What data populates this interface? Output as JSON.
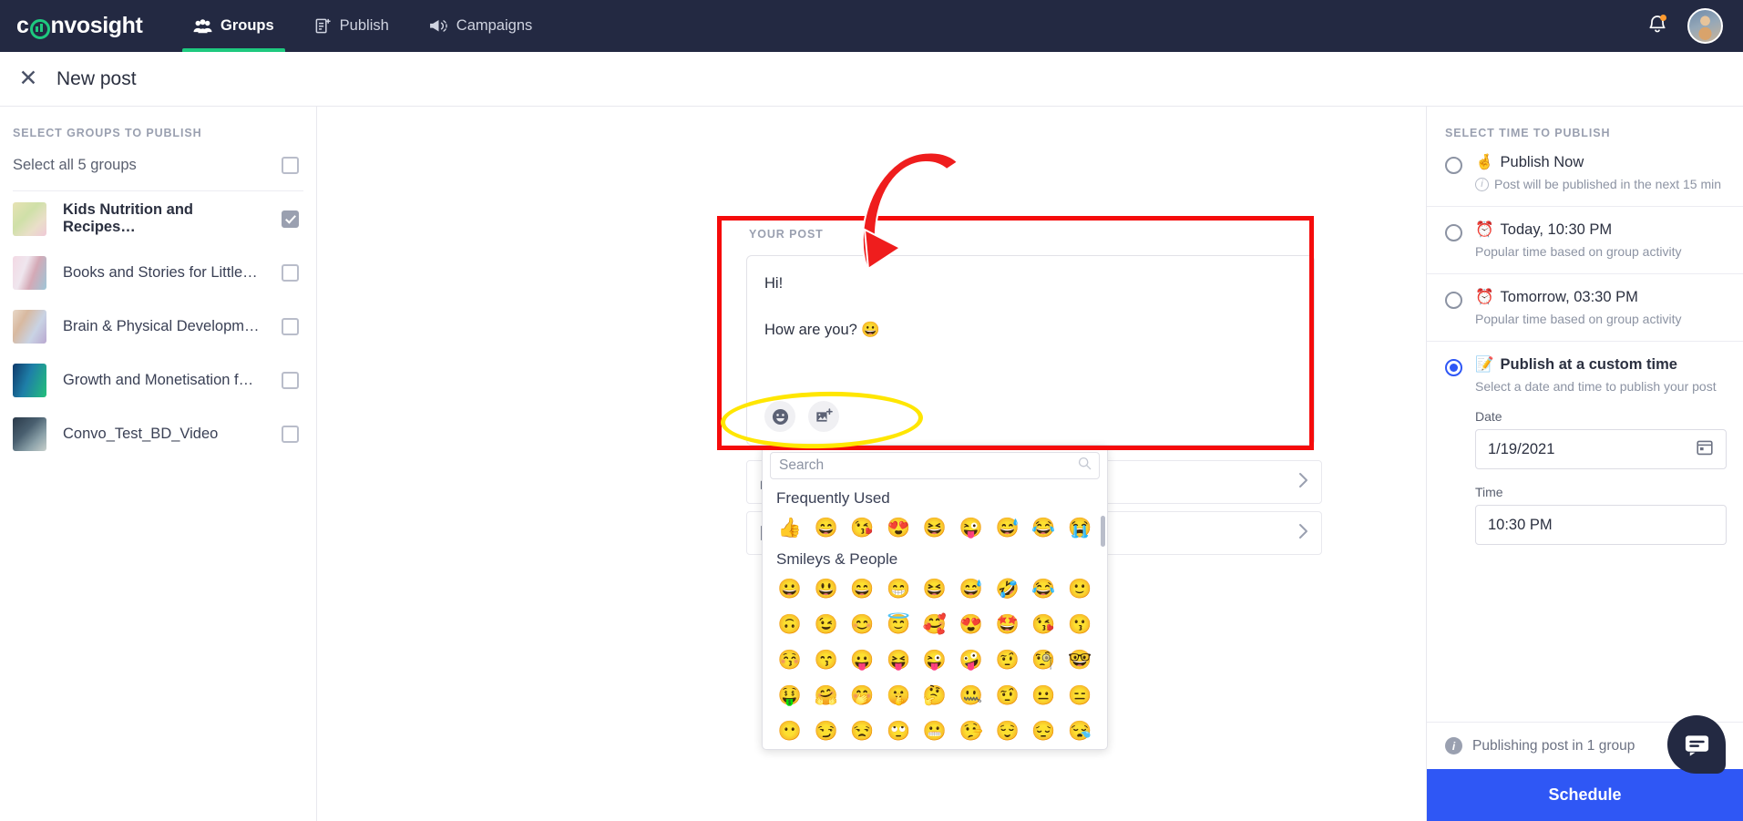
{
  "brand": {
    "name_pre": "c",
    "name_post": "nvosight"
  },
  "topnav": {
    "items": [
      {
        "label": "Groups",
        "icon": "groups-icon",
        "active": true
      },
      {
        "label": "Publish",
        "icon": "publish-icon",
        "active": false
      },
      {
        "label": "Campaigns",
        "icon": "campaigns-icon",
        "active": false
      }
    ],
    "notification_icon": "bell-icon",
    "avatar_icon": "user-avatar"
  },
  "subheader": {
    "close_icon": "close-icon",
    "title": "New post"
  },
  "left": {
    "section_label": "SELECT GROUPS TO PUBLISH",
    "select_all_label": "Select all 5 groups",
    "select_all_checked": false,
    "groups": [
      {
        "name": "Kids Nutrition and Recipes…",
        "checked": true
      },
      {
        "name": "Books and Stories for Little…",
        "checked": false
      },
      {
        "name": "Brain & Physical Developm…",
        "checked": false
      },
      {
        "name": "Growth and Monetisation f…",
        "checked": false
      },
      {
        "name": "Convo_Test_BD_Video",
        "checked": false
      }
    ]
  },
  "center": {
    "your_post_label": "YOUR POST",
    "post_lines": [
      "Hi!",
      "How are you? 😀"
    ],
    "tools": [
      {
        "label": "emoji-button",
        "icon": "emoji-smiley-icon"
      },
      {
        "label": "image-button",
        "icon": "add-image-icon"
      }
    ],
    "cards": [
      {
        "icon": "poll-icon",
        "label": ""
      },
      {
        "icon": "document-icon",
        "label": ""
      }
    ]
  },
  "emoji_picker": {
    "search_placeholder": "Search",
    "search_value": "",
    "search_icon": "search-icon",
    "categories": [
      {
        "title": "Frequently Used",
        "emojis": [
          "👍",
          "😄",
          "😘",
          "😍",
          "😆",
          "😜",
          "😅",
          "😂",
          "😭"
        ]
      },
      {
        "title": "Smileys & People",
        "emojis": [
          "😀",
          "😃",
          "😄",
          "😁",
          "😆",
          "😅",
          "🤣",
          "😂",
          "🙂",
          "🙃",
          "😉",
          "😊",
          "😇",
          "🥰",
          "😍",
          "🤩",
          "😘",
          "😗",
          "😚",
          "😙",
          "😛",
          "😝",
          "😜",
          "🤪",
          "🤨",
          "🧐",
          "🤓",
          "🤑",
          "🤗",
          "🤭",
          "🤫",
          "🤔",
          "🤐",
          "🤨",
          "😐",
          "😑",
          "😶",
          "😏",
          "😒",
          "🙄",
          "😬",
          "🤥",
          "😌",
          "😔",
          "😪"
        ]
      }
    ]
  },
  "right": {
    "section_label": "SELECT TIME TO PUBLISH",
    "options": [
      {
        "emoji": "🤞",
        "title": "Publish Now",
        "subtitle": "Post will be published in the next 15 min",
        "has_info_icon": true,
        "selected": false,
        "bold": false
      },
      {
        "emoji": "⏰",
        "title": "Today, 10:30 PM",
        "subtitle": "Popular time based on group activity",
        "has_info_icon": false,
        "selected": false,
        "bold": false
      },
      {
        "emoji": "⏰",
        "title": "Tomorrow, 03:30 PM",
        "subtitle": "Popular time based on group activity",
        "has_info_icon": false,
        "selected": false,
        "bold": false
      },
      {
        "emoji": "📝",
        "title": "Publish at a custom time",
        "subtitle": "Select a date and time to publish your post",
        "has_info_icon": false,
        "selected": true,
        "bold": true
      }
    ],
    "date_label": "Date",
    "date_value": "1/19/2021",
    "date_icon": "calendar-icon",
    "time_label": "Time",
    "time_value": "10:30 PM",
    "publishing_note": "Publishing post in 1 group",
    "schedule_label": "Schedule"
  },
  "annotations": {
    "box_color": "#f50b0b",
    "arrow_color": "#ef1d1d",
    "ellipse_color": "#ffe600"
  },
  "chat_fab": {
    "icon": "chat-bubble-icon",
    "color": "#232942"
  }
}
